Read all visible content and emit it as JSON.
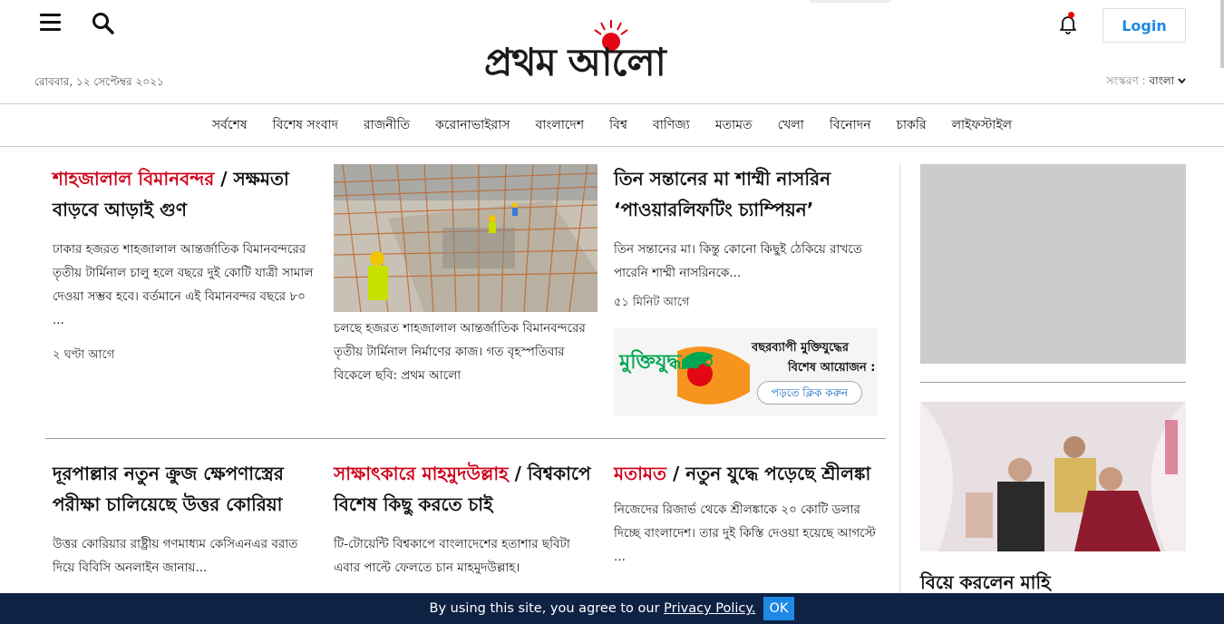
{
  "header": {
    "logo_text": "প্রথম আলো",
    "date": "রোববার, ১২ সেপ্টেম্বর ২০২১",
    "login_label": "Login",
    "edition_label": "সংস্করণ :",
    "edition_value": "বাংলা",
    "icons": [
      "menu-icon",
      "search-icon",
      "bell-icon",
      "chevron-down-icon"
    ],
    "colors": {
      "brand_red": "#e30613",
      "login_blue": "#1e88e5",
      "tag_red": "#d0021b"
    }
  },
  "nav": {
    "items": [
      {
        "label": "সর্বশেষ"
      },
      {
        "label": "বিশেষ সংবাদ"
      },
      {
        "label": "রাজনীতি"
      },
      {
        "label": "করোনাভাইরাস"
      },
      {
        "label": "বাংলাদেশ"
      },
      {
        "label": "বিশ্ব"
      },
      {
        "label": "বাণিজ্য"
      },
      {
        "label": "মতামত"
      },
      {
        "label": "খেলা"
      },
      {
        "label": "বিনোদন"
      },
      {
        "label": "চাকরি"
      },
      {
        "label": "লাইফস্টাইল"
      }
    ]
  },
  "stories": {
    "lead": {
      "tag": "শাহজালাল বিমানবন্দর",
      "title": " / সক্ষমতা বাড়বে আড়াই গুণ",
      "summary": "ঢাকার হজরত শাহজালাল আন্তর্জাতিক বিমানবন্দরের তৃতীয় টার্মিনাল চালু হলে বছরে দুই কোটি যাত্রী সামাল দেওয়া সম্ভব হবে। বর্তমানে এই বিমানবন্দর বছরে ৮০ ...",
      "time": "২ ঘণ্টা আগে"
    },
    "photo_caption": "চলছে হজরত শাহজালাল আন্তর্জাতিক বিমানবন্দরের তৃতীয় টার্মিনাল নির্মাণের কাজ। গত বৃহস্পতিবার বিকেলে ছবি: প্রথম আলো",
    "powerlifting": {
      "title": "তিন সন্তানের মা শাম্মী নাসরিন ‘পাওয়ারলিফটিং চ্যাম্পিয়ন’",
      "summary": "তিন সন্তানের মা। কিন্তু কোনো কিছুই ঠেকিয়ে রাখতে পারেনি শাম্মী নাসরিনকে...",
      "time": "৫১ মিনিট আগে"
    },
    "banner": {
      "logo_text": "মুক্তিযুদ্ধ ৫০",
      "title": "বছরব্যাপী মুক্তিযুদ্ধের",
      "subtitle": "বিশেষ আয়োজন :",
      "button": "পড়তে ক্লিক করুন"
    },
    "korea": {
      "title": "দূরপাল্লার নতুন ক্রুজ ক্ষেপণাস্ত্রের পরীক্ষা চালিয়েছে উত্তর কোরিয়া",
      "summary": "উত্তর কোরিয়ার রাষ্ট্রীয় গণমাধ্যম কেসিএনএর বরাত দিয়ে বিবিসি অনলাইন জানায়..."
    },
    "mahmudullah": {
      "tag": "সাক্ষাৎকারে মাহমুদউল্লাহ",
      "title": " / বিশ্বকাপে বিশেষ কিছু করতে চাই",
      "summary": "টি-টোয়েন্টি বিশ্বকাপে বাংলাদেশের হতাশার ছবিটা এবার পাল্টে ফেলতে চান মাহমুদউল্লাহ।"
    },
    "srilanka": {
      "tag": "মতামত",
      "title": " / নতুন যুদ্ধে পড়েছে শ্রীলঙ্কা",
      "summary": "নিজেদের রিজার্ভ থেকে শ্রীলঙ্কাকে ২০ কোটি ডলার দিচ্ছে বাংলাদেশ। তার দুই কিস্তি দেওয়া হয়েছে আগস্টে ..."
    },
    "sidebar": {
      "title": "বিয়ে করলেন মাহি"
    }
  },
  "cookie": {
    "text": "By using this site, you agree to our ",
    "link": "Privacy Policy.",
    "ok": "OK"
  }
}
